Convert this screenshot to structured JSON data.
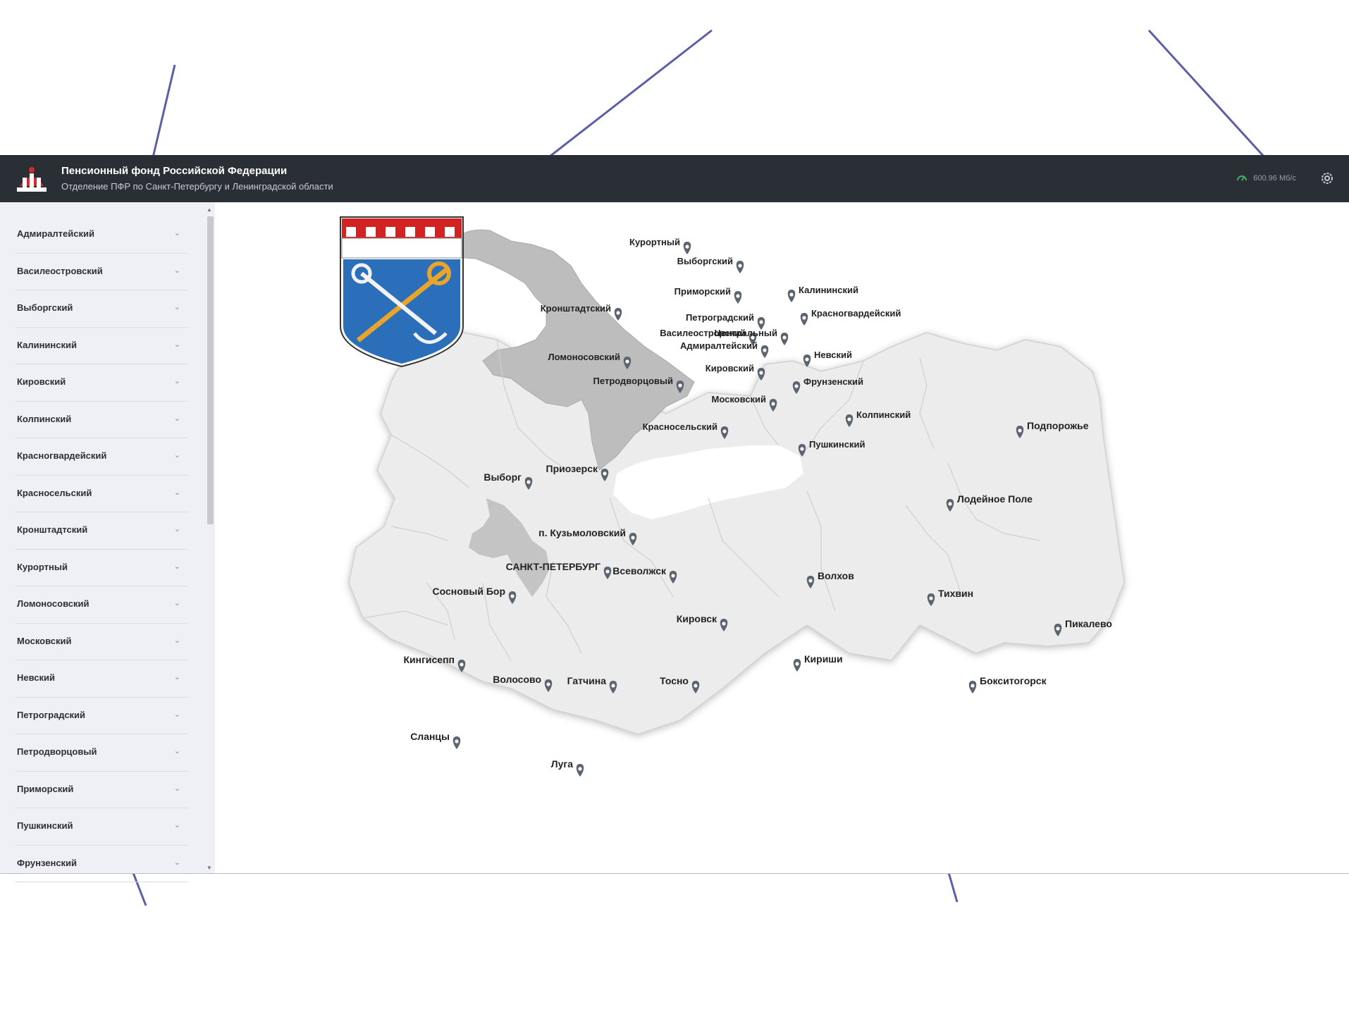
{
  "header": {
    "title": "Пенсионный фонд Российской Федерации",
    "subtitle": "Отделение ПФР по Санкт-Петербургу и Ленинградской области",
    "speed": "600.96 Мб/с",
    "logo_icon": "pfr-logo-icon",
    "settings_icon": "gear-icon"
  },
  "sidebar": {
    "items": [
      {
        "label": "Адмиралтейский"
      },
      {
        "label": "Василеостровский"
      },
      {
        "label": "Выборгский"
      },
      {
        "label": "Калининский"
      },
      {
        "label": "Кировский"
      },
      {
        "label": "Колпинский"
      },
      {
        "label": "Красногвардейский"
      },
      {
        "label": "Красносельский"
      },
      {
        "label": "Кронштадтский"
      },
      {
        "label": "Курортный"
      },
      {
        "label": "Ломоносовский"
      },
      {
        "label": "Московский"
      },
      {
        "label": "Невский"
      },
      {
        "label": "Петроградский"
      },
      {
        "label": "Петродворцовый"
      },
      {
        "label": "Приморский"
      },
      {
        "label": "Пушкинский"
      },
      {
        "label": "Фрунзенский"
      }
    ]
  },
  "map": {
    "coat_of_arms_icon": "leningrad-oblast-coat-of-arms-icon",
    "city_labels": [
      "Курортный",
      "Выборгский",
      "Приморский",
      "Калининский",
      "Кронштадтский",
      "Петроградский",
      "Красногвардейский",
      "Василеостровский",
      "Центральный",
      "Адмиралтейский",
      "Ломоносовский",
      "Невский",
      "Кировский",
      "Петродворцовый",
      "Фрунзенский",
      "Московский",
      "Колпинский",
      "Красносельский",
      "Пушкинский"
    ],
    "oblast_labels": [
      "Подпорожье",
      "Приозерск",
      "Выборг",
      "Лодейное Поле",
      "п. Кузьмоловский",
      "САНКТ-ПЕТЕРБУРГ",
      "Всеволжск",
      "Волхов",
      "Сосновый Бор",
      "Тихвин",
      "Кировск",
      "Пикалево",
      "Кингисепп",
      "Кириши",
      "Волосово",
      "Гатчина",
      "Тосно",
      "Бокситогорск",
      "Сланцы",
      "Луга"
    ]
  }
}
